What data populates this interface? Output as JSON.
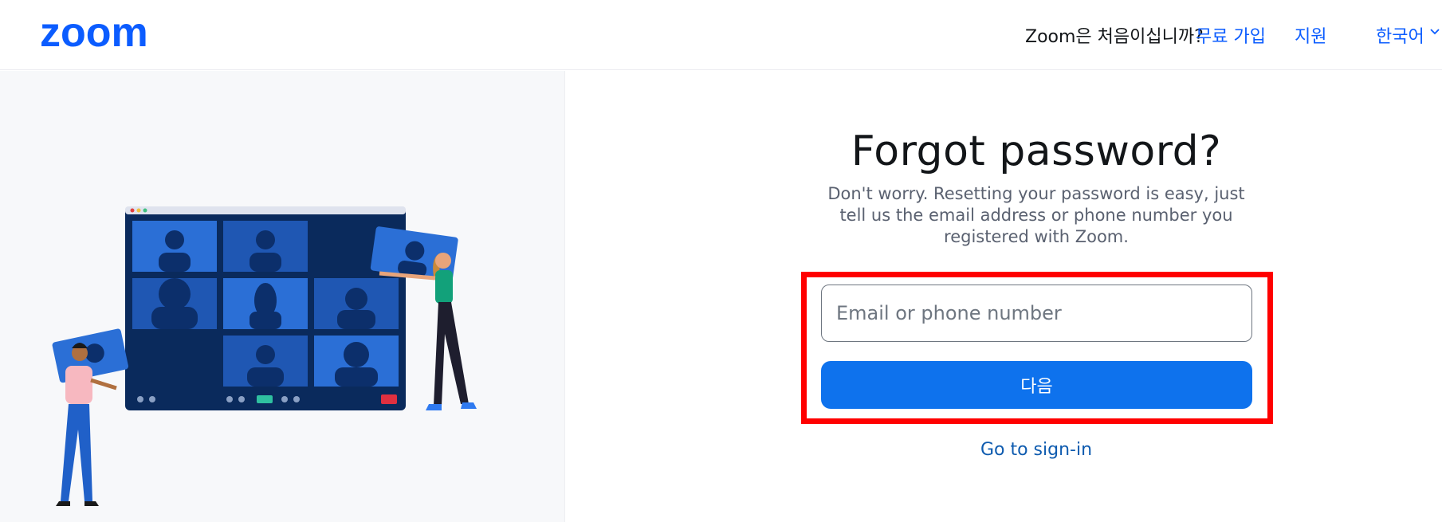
{
  "header": {
    "logo_text": "zoom",
    "new_question": "Zoom은 처음이십니까?",
    "signup_label": "무료 가입",
    "support_label": "지원",
    "language_label": "한국어"
  },
  "main": {
    "title": "Forgot password?",
    "description": "Don't worry. Resetting your password is easy, just tell us the email address or phone number you registered with Zoom.",
    "email_placeholder": "Email or phone number",
    "email_value": "",
    "next_label": "다음",
    "signin_link": "Go to sign-in"
  },
  "colors": {
    "brand": "#0b5cff",
    "button": "#0e72ed",
    "highlight": "#ff0000",
    "panel_bg": "#f7f8fa"
  }
}
